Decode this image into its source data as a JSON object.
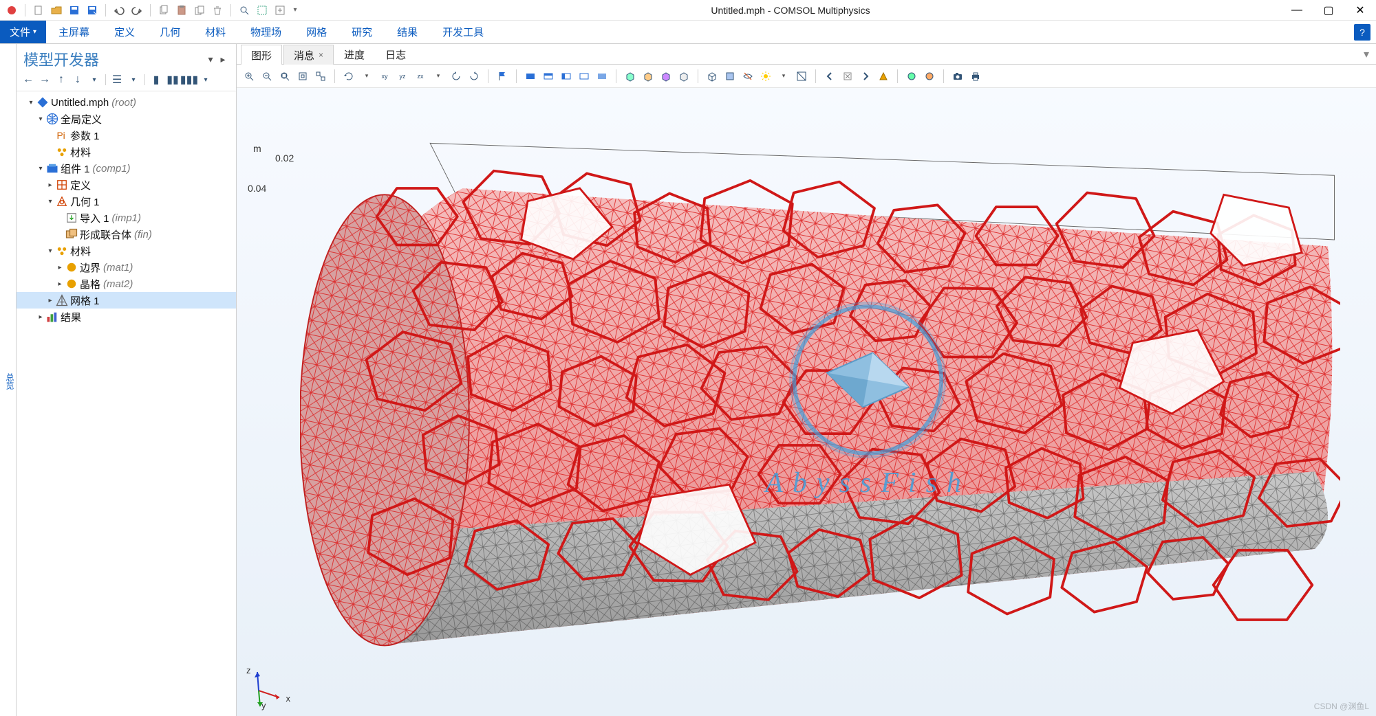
{
  "window": {
    "title": "Untitled.mph - COMSOL Multiphysics",
    "min": "—",
    "max": "▢",
    "close": "✕"
  },
  "qat": [
    "new",
    "open",
    "save",
    "save-as",
    "sep",
    "undo",
    "redo",
    "sep",
    "copy",
    "paste",
    "duplicate",
    "delete",
    "sep",
    "search",
    "select",
    "sep",
    "settings"
  ],
  "ribbon": {
    "file": "文件",
    "file_caret": "▾",
    "tabs": [
      "主屏幕",
      "定义",
      "几何",
      "材料",
      "物理场",
      "网格",
      "研究",
      "结果",
      "开发工具"
    ],
    "help": "?"
  },
  "builder": {
    "title": "模型开发器",
    "pin": "▾",
    "tools_caret": "▸",
    "tools": [
      "back",
      "fwd",
      "up",
      "down",
      "sep",
      "expand",
      "sep",
      "col1",
      "col2",
      "col3",
      "caret"
    ],
    "tree": [
      {
        "depth": 0,
        "exp": "▾",
        "icon": "root",
        "label": "Untitled.mph",
        "ann": "(root)"
      },
      {
        "depth": 1,
        "exp": "▾",
        "icon": "globe",
        "label": "全局定义",
        "ann": ""
      },
      {
        "depth": 2,
        "exp": "",
        "icon": "param",
        "label": "参数 1",
        "ann": ""
      },
      {
        "depth": 2,
        "exp": "",
        "icon": "mat",
        "label": "材料",
        "ann": ""
      },
      {
        "depth": 1,
        "exp": "▾",
        "icon": "comp",
        "label": "组件 1",
        "ann": "(comp1)"
      },
      {
        "depth": 2,
        "exp": "▸",
        "icon": "def",
        "label": "定义",
        "ann": ""
      },
      {
        "depth": 2,
        "exp": "▾",
        "icon": "geom",
        "label": "几何 1",
        "ann": ""
      },
      {
        "depth": 3,
        "exp": "",
        "icon": "import",
        "label": "导入 1",
        "ann": "(imp1)"
      },
      {
        "depth": 3,
        "exp": "",
        "icon": "union",
        "label": "形成联合体",
        "ann": "(fin)"
      },
      {
        "depth": 2,
        "exp": "▾",
        "icon": "mat",
        "label": "材料",
        "ann": ""
      },
      {
        "depth": 3,
        "exp": "▸",
        "icon": "matitem",
        "label": "边界",
        "ann": "(mat1)"
      },
      {
        "depth": 3,
        "exp": "▸",
        "icon": "matitem",
        "label": "晶格",
        "ann": "(mat2)"
      },
      {
        "depth": 2,
        "exp": "▸",
        "icon": "mesh",
        "label": "网格 1",
        "ann": "",
        "sel": true
      },
      {
        "depth": 1,
        "exp": "▸",
        "icon": "results",
        "label": "结果",
        "ann": ""
      }
    ]
  },
  "graphics": {
    "tabs": [
      {
        "label": "图形",
        "active": true
      },
      {
        "label": "消息",
        "active": false,
        "close": "×"
      },
      {
        "label": "进度",
        "active": false
      },
      {
        "label": "日志",
        "active": false
      }
    ],
    "collapse": "▾",
    "toolbar_groups": [
      [
        "zoom-in",
        "zoom-out",
        "zoom-extents",
        "zoom-box",
        "zoom-sel"
      ],
      [
        "rotate",
        "caret",
        "xy",
        "yz",
        "zx",
        "caret2",
        "ccw",
        "cw"
      ],
      [
        "flag"
      ],
      [
        "view-sel1",
        "view-sel2",
        "view-sel3",
        "view-sel4",
        "view-sel5"
      ],
      [
        "box1",
        "box2",
        "box3",
        "box4"
      ],
      [
        "wire",
        "trans",
        "hide",
        "light",
        "caret3",
        "clip"
      ],
      [
        "go-left",
        "del",
        "go-right",
        "tri"
      ],
      [
        "plot1",
        "plot2"
      ],
      [
        "camera",
        "print"
      ]
    ],
    "axis": {
      "unit": "m",
      "ticks": [
        "0.02",
        "0.04"
      ]
    },
    "triad": {
      "x": "x",
      "y": "y",
      "z": "z"
    },
    "watermark": "AbyssFish",
    "csdn": "CSDN @渊鱼L"
  }
}
